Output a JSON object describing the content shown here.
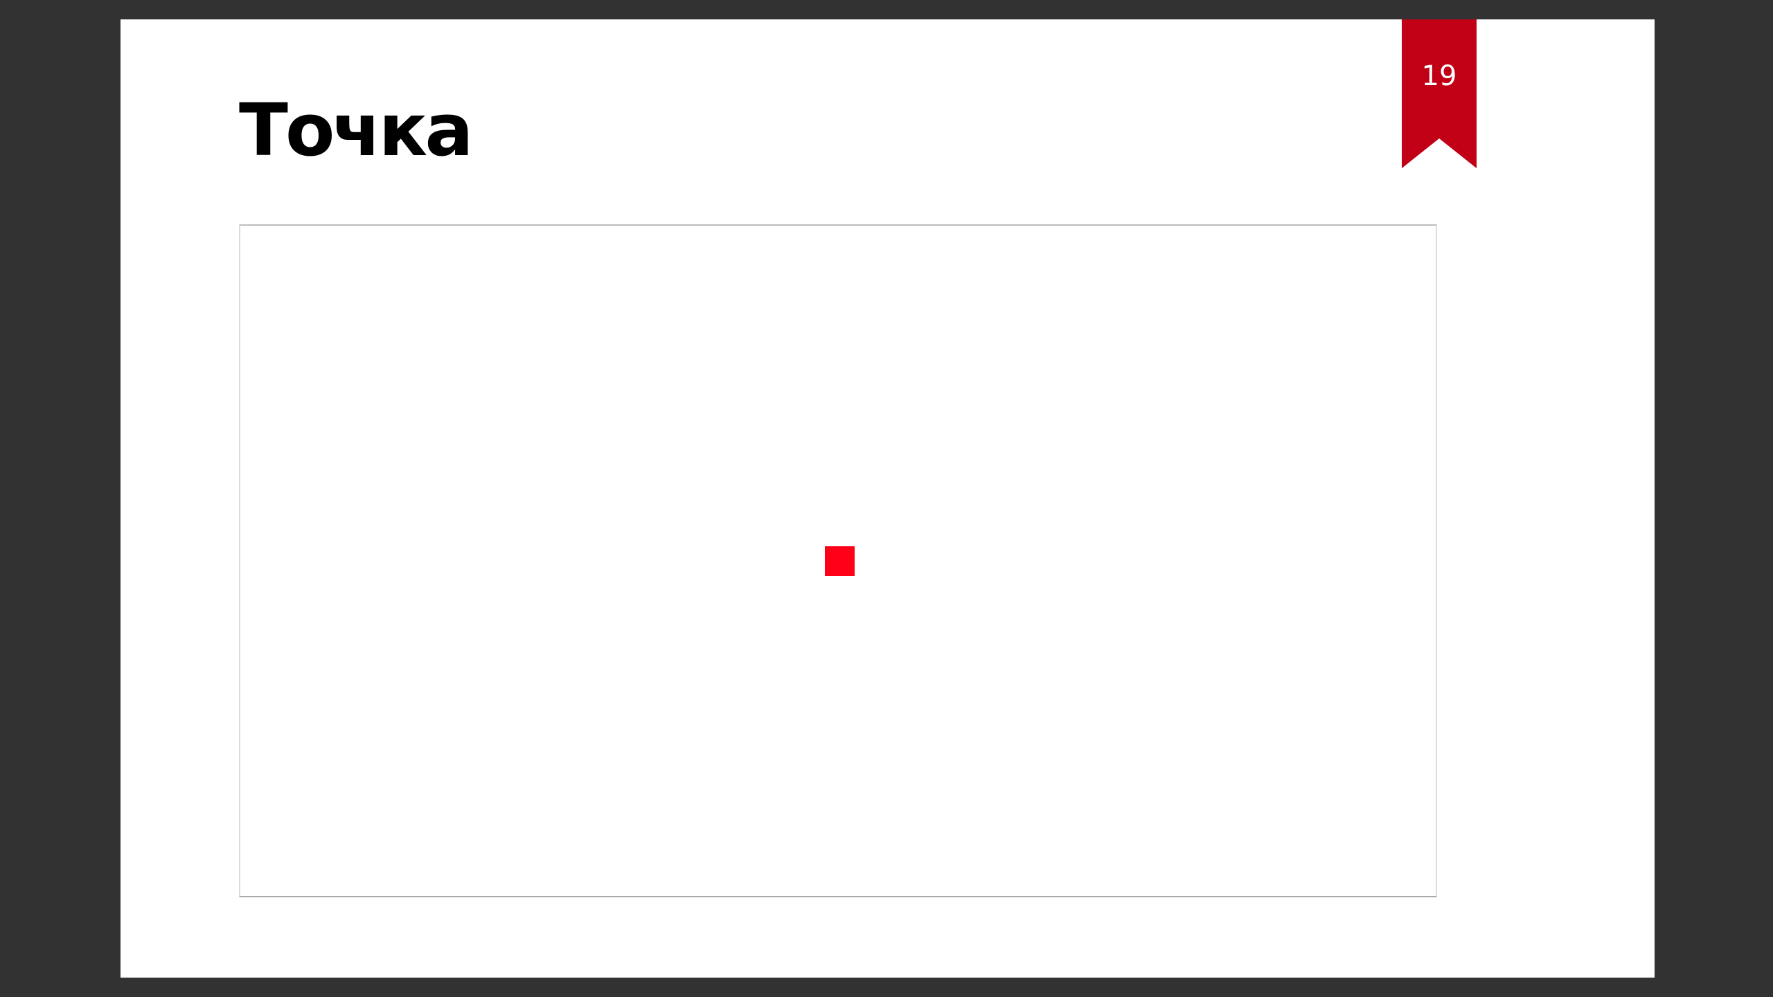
{
  "slide": {
    "title": "Точка",
    "page_number": "19"
  },
  "icons": {
    "bookmark": "bookmark-ribbon-icon"
  },
  "colors": {
    "background": "#323232",
    "slide": "#ffffff",
    "ribbon": "#c10016",
    "point": "#ff0018",
    "canvas_border": "#dcdcdc"
  }
}
